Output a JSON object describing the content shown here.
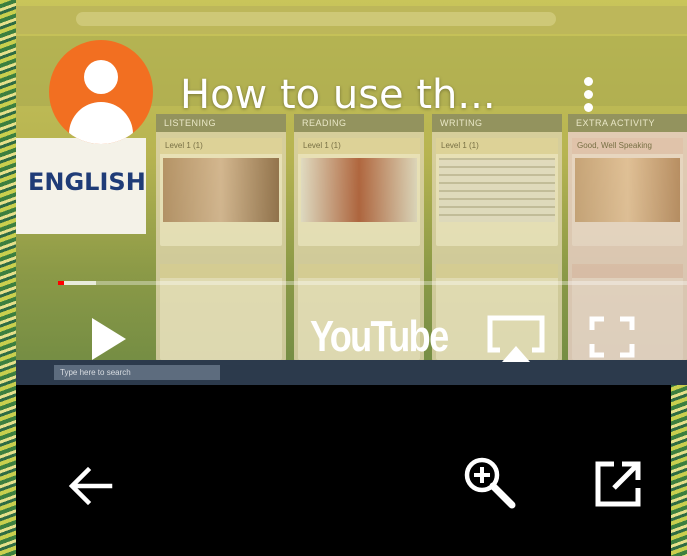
{
  "video": {
    "title": "How to use th...",
    "brand": "YouTube",
    "progress_buffered": 0.06,
    "progress_played": 0.01
  },
  "preview": {
    "columns": [
      "LISTENING",
      "READING",
      "WRITING",
      "EXTRA ACTIVITY"
    ],
    "card_heads": [
      "Level 1 (1)",
      "Level 1 (1)",
      "Level 1 (1)",
      "Good, Well Speaking"
    ],
    "english_word": "ENGLISH",
    "taskbar_search": "Type here to search"
  },
  "colors": {
    "avatar": "#f26f21",
    "progress_played": "#ff0000",
    "background": "#000000"
  },
  "icons": {
    "avatar": "person-avatar-icon",
    "menu": "more-vert-icon",
    "play": "play-icon",
    "cast": "airplay-icon",
    "fullscreen": "fullscreen-icon",
    "back": "arrow-back-icon",
    "zoom": "zoom-in-icon",
    "open": "open-external-icon"
  }
}
